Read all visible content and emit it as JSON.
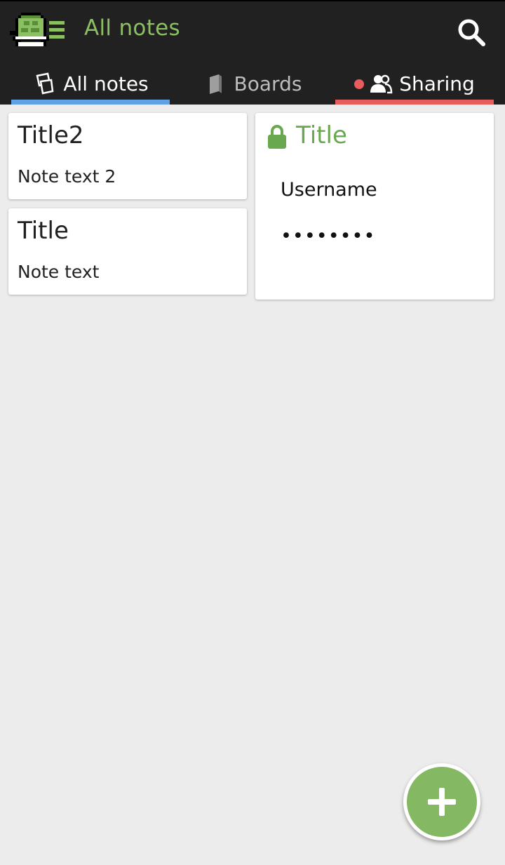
{
  "app": {
    "title": "All notes"
  },
  "tabs": [
    {
      "label": "All notes",
      "icon": "notes-icon",
      "indicator_color": "#5fa0e6"
    },
    {
      "label": "Boards",
      "icon": "book-icon"
    },
    {
      "label": "Sharing",
      "icon": "people-icon",
      "indicator_color": "#e85c5c",
      "has_badge": true
    }
  ],
  "notes": [
    {
      "title": "Title2",
      "text": "Note text 2"
    },
    {
      "title": "Title",
      "text": "Note text"
    }
  ],
  "locked_note": {
    "title": "Title",
    "username": "Username",
    "password": "••••••••",
    "icon": "lock-icon"
  },
  "fab": {
    "icon": "plus-icon"
  },
  "colors": {
    "accent": "#8bbf62",
    "toolbar": "#212121",
    "background": "#ececec"
  }
}
